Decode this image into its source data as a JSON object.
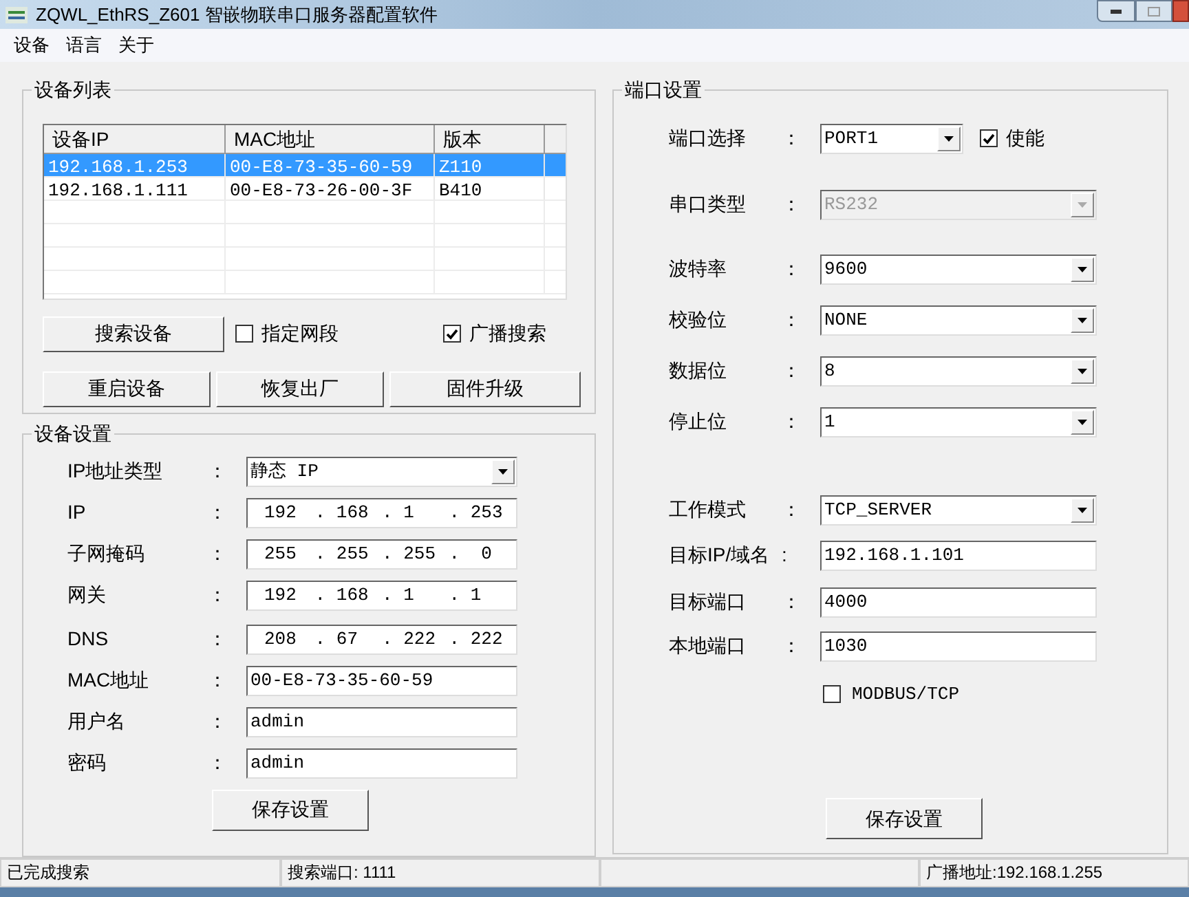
{
  "window": {
    "title": "ZQWL_EthRS_Z601  智嵌物联串口服务器配置软件"
  },
  "menu": [
    "设备",
    "语言",
    "关于"
  ],
  "device_list": {
    "title": "设备列表",
    "columns": [
      "设备IP",
      "MAC地址",
      "版本"
    ],
    "rows": [
      {
        "cells": [
          "192.168.1.253",
          "00-E8-73-35-60-59",
          "Z110"
        ],
        "selected": true
      },
      {
        "cells": [
          "192.168.1.111",
          "00-E8-73-26-00-3F",
          "B410"
        ],
        "selected": false
      }
    ],
    "search_button": "搜索设备",
    "checkboxes": [
      {
        "label": "指定网段",
        "checked": false
      },
      {
        "label": "广播搜索",
        "checked": true
      }
    ],
    "buttons": [
      "重启设备",
      "恢复出厂",
      "固件升级"
    ]
  },
  "device_settings": {
    "title": "设备设置",
    "fields": [
      {
        "kind": "select",
        "label": "IP地址类型",
        "colon": "：",
        "value": "静态 IP"
      },
      {
        "kind": "ip",
        "label": "IP",
        "colon": "：",
        "segments": [
          "192",
          ". 168",
          ". 1",
          ". 253"
        ]
      },
      {
        "kind": "ip",
        "label": "子网掩码",
        "colon": "：",
        "segments": [
          "255",
          ". 255",
          ". 255",
          ".  0"
        ]
      },
      {
        "kind": "ip",
        "label": "网关",
        "colon": "：",
        "segments": [
          "192",
          ". 168",
          ". 1",
          ". 1"
        ]
      },
      {
        "kind": "ip",
        "label": "DNS",
        "colon": "：",
        "segments": [
          "208",
          ". 67",
          ". 222",
          ". 222"
        ]
      },
      {
        "kind": "text",
        "label": "MAC地址",
        "colon": "：",
        "value": "00-E8-73-35-60-59"
      },
      {
        "kind": "text",
        "label": "用户名",
        "colon": "：",
        "value": "admin"
      },
      {
        "kind": "text",
        "label": "密码",
        "colon": "：",
        "value": "admin"
      }
    ],
    "save_button": "保存设置"
  },
  "port_settings": {
    "title": "端口设置",
    "port_select": {
      "label": "端口选择",
      "colon": "：",
      "value": "PORT1"
    },
    "enable": {
      "label": "使能",
      "checked": true
    },
    "fields": [
      {
        "kind": "select",
        "label": "串口类型",
        "colon": "：",
        "value": "RS232",
        "disabled": true
      },
      {
        "kind": "select",
        "label": "波特率",
        "colon": "：",
        "value": "9600",
        "disabled": false
      },
      {
        "kind": "select",
        "label": "校验位",
        "colon": "：",
        "value": "NONE",
        "disabled": false
      },
      {
        "kind": "select",
        "label": "数据位",
        "colon": "：",
        "value": "8",
        "disabled": false
      },
      {
        "kind": "select",
        "label": "停止位",
        "colon": "：",
        "value": "1",
        "disabled": false
      },
      {
        "kind": "select",
        "label": "工作模式",
        "colon": "：",
        "value": "TCP_SERVER",
        "disabled": false
      },
      {
        "kind": "text",
        "label": "目标IP/域名",
        "colon": ":",
        "value": "192.168.1.101"
      },
      {
        "kind": "text",
        "label": "目标端口",
        "colon": "：",
        "value": "4000"
      },
      {
        "kind": "text",
        "label": "本地端口",
        "colon": "：",
        "value": "1030"
      }
    ],
    "modbus": {
      "label": "MODBUS/TCP",
      "checked": false
    },
    "save_button": "保存设置"
  },
  "status_bar": [
    "已完成搜索",
    "搜索端口: 1111",
    "广播地址:192.168.1.255"
  ]
}
